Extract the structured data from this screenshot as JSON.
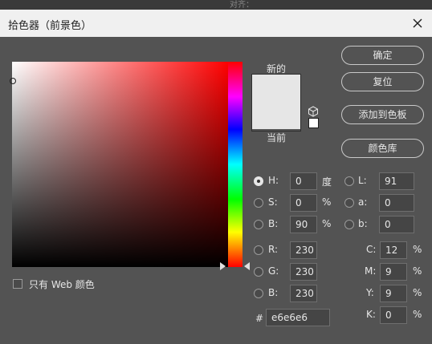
{
  "window": {
    "title": "拾色器（前景色）"
  },
  "background": {
    "hint_text": "对齐："
  },
  "preview": {
    "new_label": "新的",
    "current_label": "当前",
    "new_color": "#e6e6e6",
    "current_color": "#e6e6e6"
  },
  "buttons": {
    "ok": "确定",
    "reset": "复位",
    "add_to_swatches": "添加到色板",
    "color_libraries": "颜色库"
  },
  "hsb": {
    "selected": "H",
    "h": {
      "label": "H:",
      "value": "0",
      "unit": "度"
    },
    "s": {
      "label": "S:",
      "value": "0",
      "unit": "%"
    },
    "b": {
      "label": "B:",
      "value": "90",
      "unit": "%"
    }
  },
  "lab": {
    "l": {
      "label": "L:",
      "value": "91"
    },
    "a": {
      "label": "a:",
      "value": "0"
    },
    "b": {
      "label": "b:",
      "value": "0"
    }
  },
  "rgb": {
    "r": {
      "label": "R:",
      "value": "230"
    },
    "g": {
      "label": "G:",
      "value": "230"
    },
    "b": {
      "label": "B:",
      "value": "230"
    }
  },
  "cmyk": {
    "c": {
      "label": "C:",
      "value": "12",
      "unit": "%"
    },
    "m": {
      "label": "M:",
      "value": "9",
      "unit": "%"
    },
    "y": {
      "label": "Y:",
      "value": "9",
      "unit": "%"
    },
    "k": {
      "label": "K:",
      "value": "0",
      "unit": "%"
    }
  },
  "hex": {
    "label": "#",
    "value": "e6e6e6"
  },
  "web_colors_only": {
    "label": "只有 Web 颜色",
    "checked": false
  },
  "icons": {
    "close": "close-icon",
    "cube": "cube-icon"
  }
}
